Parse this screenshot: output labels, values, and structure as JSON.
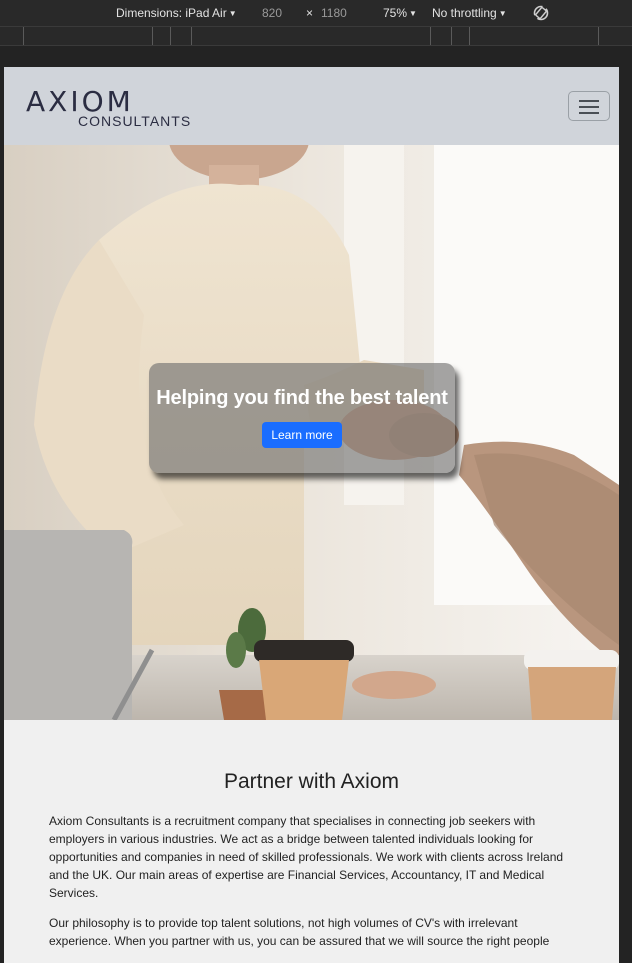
{
  "devtools": {
    "dimensions_label": "Dimensions: iPad Air",
    "width": "820",
    "times": "×",
    "height": "1180",
    "zoom": "75%",
    "throttling": "No throttling",
    "rotate_icon": "rotate-icon"
  },
  "navbar": {
    "logo_top": "AXIOM",
    "logo_bottom": "CONSULTANTS",
    "menu_icon": "hamburger-icon"
  },
  "hero": {
    "title": "Helping you find the best talent",
    "button_label": "Learn more"
  },
  "about": {
    "heading": "Partner with Axiom",
    "paragraph1": "Axiom Consultants is a recruitment company that specialises in connecting job seekers with employers in various industries. We act as a bridge between talented individuals looking for opportunities and companies in need of skilled professionals. We work with clients across Ireland and the UK. Our main areas of expertise are Financial Services, Accountancy, IT and Medical Services.",
    "paragraph2": "Our philosophy is to provide top talent solutions, not high volumes of CV's with irrelevant experience. When you partner with us, you can be assured that we will source the right people"
  },
  "colors": {
    "navbar_bg": "#d0d4da",
    "accent_button": "#1a6dff",
    "page_bg": "#f0f0f0"
  }
}
